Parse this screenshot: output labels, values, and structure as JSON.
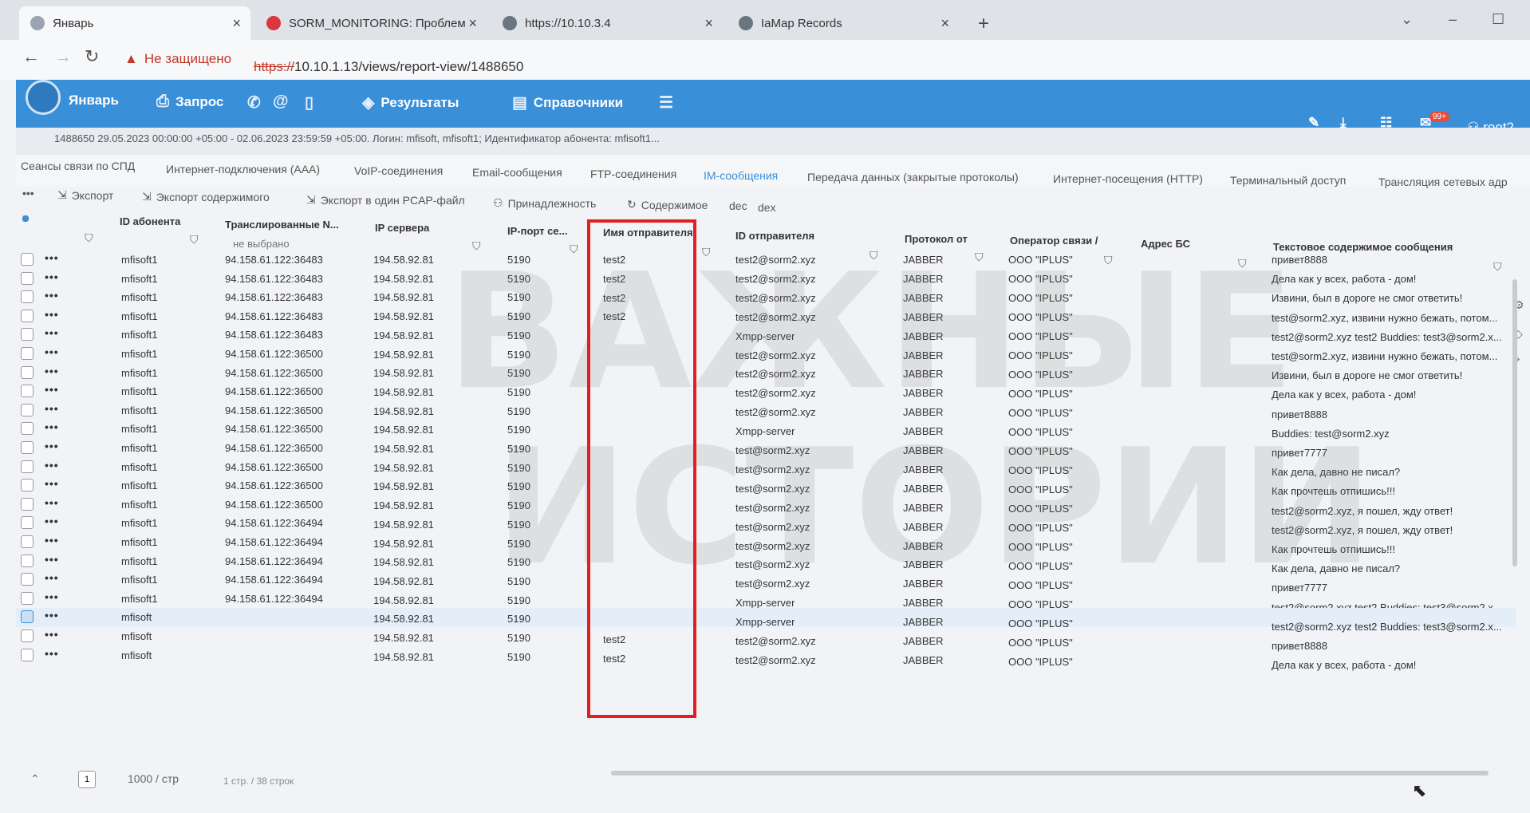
{
  "browser": {
    "tabs": [
      {
        "label": "Январь",
        "color": "#9aa5b1"
      },
      {
        "label": "SORM_MONITORING: Проблем",
        "color": "#d9363e"
      },
      {
        "label": "https://10.10.3.4",
        "color": "#6b7580"
      },
      {
        "label": "IaMap Records",
        "color": "#6b7580"
      }
    ],
    "not_secure": "Не защищено",
    "url_scheme": "https://",
    "url_rest": "10.10.1.13/views/report-view/1488650"
  },
  "app": {
    "brand": "Январь",
    "nav": {
      "query": "Запрос",
      "results": "Результаты",
      "directories": "Справочники"
    },
    "user": "root2",
    "notif_badge": "99+",
    "accent": "#3a8fd9"
  },
  "info_line": "1488650  29.05.2023 00:00:00 +05:00 - 02.06.2023 23:59:59 +05:00. Логин: mfisoft, mfisoft1; Идентификатор абонента: mfisoft1...",
  "subtabs": [
    "Сеансы связи по СПД",
    "Интернет-подключения (AAA)",
    "VoIP-соединения",
    "Email-сообщения",
    "FTP-соединения",
    "IM-сообщения",
    "Передача данных (закрытые протоколы)",
    "Интернет-посещения (HTTP)",
    "Терминальный доступ",
    "Трансляция сетевых адр"
  ],
  "toolbar": {
    "export": "Экспорт",
    "export_content": "Экспорт содержимого",
    "export_pcap": "Экспорт в один PCAP-файл",
    "ownership": "Принадлежность",
    "content": "Содержимое",
    "dec": "dec",
    "hex": "dex"
  },
  "columns": {
    "subscriber_id": "ID абонента",
    "translated": "Транслированные N...",
    "translated_sub": "не выбрано",
    "server_ip": "IP сервера",
    "server_port": "IP-порт се...",
    "sender_name": "Имя отправителя",
    "sender_id": "ID отправителя",
    "protocol": "Протокол от",
    "operator": "Оператор связи /",
    "bs_address": "Адрес БС",
    "message": "Текстовое содержимое сообщения"
  },
  "rows": [
    {
      "sub": "mfisoft1",
      "tr": "94.158.61.122:36483",
      "ip": "194.58.92.81",
      "port": "5190",
      "name": "test2",
      "sid": "test2@sorm2.xyz",
      "proto": "JABBER",
      "op": "ООО \"IPLUS\"",
      "msg": "привет8888"
    },
    {
      "sub": "mfisoft1",
      "tr": "94.158.61.122:36483",
      "ip": "194.58.92.81",
      "port": "5190",
      "name": "test2",
      "sid": "test2@sorm2.xyz",
      "proto": "JABBER",
      "op": "ООО \"IPLUS\"",
      "msg": "Дела как у всех, работа - дом!"
    },
    {
      "sub": "mfisoft1",
      "tr": "94.158.61.122:36483",
      "ip": "194.58.92.81",
      "port": "5190",
      "name": "test2",
      "sid": "test2@sorm2.xyz",
      "proto": "JABBER",
      "op": "ООО \"IPLUS\"",
      "msg": "Извини, был в дороге не смог ответить!"
    },
    {
      "sub": "mfisoft1",
      "tr": "94.158.61.122:36483",
      "ip": "194.58.92.81",
      "port": "5190",
      "name": "test2",
      "sid": "test2@sorm2.xyz",
      "proto": "JABBER",
      "op": "ООО \"IPLUS\"",
      "msg": "test@sorm2.xyz, извини нужно бежать, потом..."
    },
    {
      "sub": "mfisoft1",
      "tr": "94.158.61.122:36483",
      "ip": "194.58.92.81",
      "port": "5190",
      "name": "",
      "sid": "Xmpp-server",
      "proto": "JABBER",
      "op": "ООО \"IPLUS\"",
      "msg": "test2@sorm2.xyz test2 Buddies: test3@sorm2.x..."
    },
    {
      "sub": "mfisoft1",
      "tr": "94.158.61.122:36500",
      "ip": "194.58.92.81",
      "port": "5190",
      "name": "",
      "sid": "test2@sorm2.xyz",
      "proto": "JABBER",
      "op": "ООО \"IPLUS\"",
      "msg": "test@sorm2.xyz, извини нужно бежать, потом..."
    },
    {
      "sub": "mfisoft1",
      "tr": "94.158.61.122:36500",
      "ip": "194.58.92.81",
      "port": "5190",
      "name": "",
      "sid": "test2@sorm2.xyz",
      "proto": "JABBER",
      "op": "ООО \"IPLUS\"",
      "msg": "Извини, был в дороге не смог ответить!"
    },
    {
      "sub": "mfisoft1",
      "tr": "94.158.61.122:36500",
      "ip": "194.58.92.81",
      "port": "5190",
      "name": "",
      "sid": "test2@sorm2.xyz",
      "proto": "JABBER",
      "op": "ООО \"IPLUS\"",
      "msg": "Дела как у всех, работа - дом!"
    },
    {
      "sub": "mfisoft1",
      "tr": "94.158.61.122:36500",
      "ip": "194.58.92.81",
      "port": "5190",
      "name": "",
      "sid": "test2@sorm2.xyz",
      "proto": "JABBER",
      "op": "ООО \"IPLUS\"",
      "msg": "привет8888"
    },
    {
      "sub": "mfisoft1",
      "tr": "94.158.61.122:36500",
      "ip": "194.58.92.81",
      "port": "5190",
      "name": "",
      "sid": "Xmpp-server",
      "proto": "JABBER",
      "op": "ООО \"IPLUS\"",
      "msg": "Buddies: test@sorm2.xyz"
    },
    {
      "sub": "mfisoft1",
      "tr": "94.158.61.122:36500",
      "ip": "194.58.92.81",
      "port": "5190",
      "name": "",
      "sid": "test@sorm2.xyz",
      "proto": "JABBER",
      "op": "ООО \"IPLUS\"",
      "msg": "привет7777"
    },
    {
      "sub": "mfisoft1",
      "tr": "94.158.61.122:36500",
      "ip": "194.58.92.81",
      "port": "5190",
      "name": "",
      "sid": "test@sorm2.xyz",
      "proto": "JABBER",
      "op": "ООО \"IPLUS\"",
      "msg": "Как дела, давно не писал?"
    },
    {
      "sub": "mfisoft1",
      "tr": "94.158.61.122:36500",
      "ip": "194.58.92.81",
      "port": "5190",
      "name": "",
      "sid": "test@sorm2.xyz",
      "proto": "JABBER",
      "op": "ООО \"IPLUS\"",
      "msg": "Как прочтешь отпишись!!!"
    },
    {
      "sub": "mfisoft1",
      "tr": "94.158.61.122:36500",
      "ip": "194.58.92.81",
      "port": "5190",
      "name": "",
      "sid": "test@sorm2.xyz",
      "proto": "JABBER",
      "op": "ООО \"IPLUS\"",
      "msg": "test2@sorm2.xyz, я пошел, жду ответ!"
    },
    {
      "sub": "mfisoft1",
      "tr": "94.158.61.122:36494",
      "ip": "194.58.92.81",
      "port": "5190",
      "name": "",
      "sid": "test@sorm2.xyz",
      "proto": "JABBER",
      "op": "ООО \"IPLUS\"",
      "msg": "test2@sorm2.xyz, я пошел, жду ответ!"
    },
    {
      "sub": "mfisoft1",
      "tr": "94.158.61.122:36494",
      "ip": "194.58.92.81",
      "port": "5190",
      "name": "",
      "sid": "test@sorm2.xyz",
      "proto": "JABBER",
      "op": "ООО \"IPLUS\"",
      "msg": "Как прочтешь отпишись!!!"
    },
    {
      "sub": "mfisoft1",
      "tr": "94.158.61.122:36494",
      "ip": "194.58.92.81",
      "port": "5190",
      "name": "",
      "sid": "test@sorm2.xyz",
      "proto": "JABBER",
      "op": "ООО \"IPLUS\"",
      "msg": "Как дела, давно не писал?"
    },
    {
      "sub": "mfisoft1",
      "tr": "94.158.61.122:36494",
      "ip": "194.58.92.81",
      "port": "5190",
      "name": "",
      "sid": "test@sorm2.xyz",
      "proto": "JABBER",
      "op": "ООО \"IPLUS\"",
      "msg": "привет7777"
    },
    {
      "sub": "mfisoft1",
      "tr": "94.158.61.122:36494",
      "ip": "194.58.92.81",
      "port": "5190",
      "name": "",
      "sid": "Xmpp-server",
      "proto": "JABBER",
      "op": "ООО \"IPLUS\"",
      "msg": "test2@sorm2.xyz test2 Buddies: test3@sorm2.x..."
    },
    {
      "sub": "mfisoft",
      "tr": "",
      "ip": "194.58.92.81",
      "port": "5190",
      "name": "",
      "sid": "Xmpp-server",
      "proto": "JABBER",
      "op": "ООО \"IPLUS\"",
      "msg": "test2@sorm2.xyz test2 Buddies: test3@sorm2.x...",
      "selected": true
    },
    {
      "sub": "mfisoft",
      "tr": "",
      "ip": "194.58.92.81",
      "port": "5190",
      "name": "test2",
      "sid": "test2@sorm2.xyz",
      "proto": "JABBER",
      "op": "ООО \"IPLUS\"",
      "msg": "привет8888"
    },
    {
      "sub": "mfisoft",
      "tr": "",
      "ip": "194.58.92.81",
      "port": "5190",
      "name": "test2",
      "sid": "test2@sorm2.xyz",
      "proto": "JABBER",
      "op": "ООО \"IPLUS\"",
      "msg": "Дела как у всех, работа - дом!"
    }
  ],
  "footer": {
    "page": "1",
    "per_page": "1000 / стр",
    "summary": "1 стр. / 38 строк"
  },
  "watermark": [
    "ВАЖНЫЕ",
    "ИСТОРИИ"
  ]
}
